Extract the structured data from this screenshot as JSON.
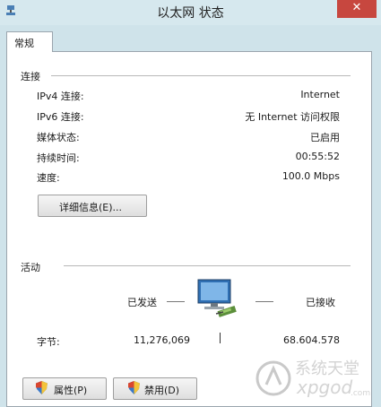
{
  "window": {
    "title": "以太网 状态",
    "close_glyph": "✕"
  },
  "tabs": [
    {
      "label": "常规"
    }
  ],
  "connection": {
    "section_label": "连接",
    "rows": [
      {
        "label": "IPv4 连接:",
        "value": "Internet"
      },
      {
        "label": "IPv6 连接:",
        "value": "无 Internet 访问权限"
      },
      {
        "label": "媒体状态:",
        "value": "已启用"
      },
      {
        "label": "持续时间:",
        "value": "00:55:52"
      },
      {
        "label": "速度:",
        "value": "100.0 Mbps"
      }
    ],
    "details_button": "详细信息(E)..."
  },
  "activity": {
    "section_label": "活动",
    "sent_label": "已发送",
    "received_label": "已接收",
    "bytes_label": "字节:",
    "bytes_sent": "11,276,069",
    "bytes_received": "68.604.578"
  },
  "buttons": {
    "properties": "属性(P)",
    "disable": "禁用(D)"
  },
  "watermark": {
    "text": "系统天堂",
    "url_text": "xpgod.com"
  },
  "colors": {
    "titlebar": "#d6e8ee",
    "close": "#c7473f",
    "panel": "#ffffff",
    "frame": "#cfe3ea"
  },
  "icons": [
    "network-adapter-icon",
    "uac-shield-icon",
    "close-icon",
    "app-icon"
  ]
}
